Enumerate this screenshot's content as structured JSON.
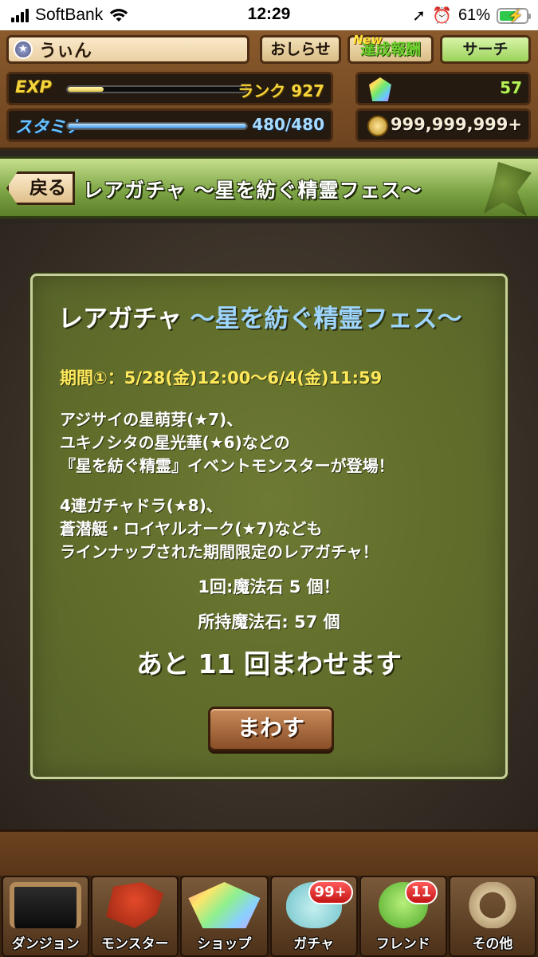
{
  "status_bar": {
    "carrier": "SoftBank",
    "time": "12:29",
    "battery": "61%",
    "battery_level": 0.61
  },
  "header": {
    "player_name": "うぃん",
    "buttons": {
      "news": "おしらせ",
      "achievements": "達成報酬",
      "achievements_badge": "New",
      "search": "サーチ"
    },
    "exp": {
      "label": "EXP",
      "rank": "ランク 927",
      "progress": 0.2
    },
    "stamina": {
      "label": "スタミナ",
      "value": "480/480",
      "progress": 1.0
    },
    "magic_stones": "57",
    "coins": "999,999,999+"
  },
  "banner": {
    "back_label": "戻る",
    "title": "レアガチャ ～星を紡ぐ精霊フェス～"
  },
  "panel": {
    "title_main": "レアガチャ",
    "title_accent": "～星を紡ぐ精霊フェス～",
    "period": "期間①：5/28(金)12:00～6/4(金)11:59",
    "desc1": [
      "アジサイの星萌芽(★7)、",
      "ユキノシタの星光華(★6)などの",
      "『星を紡ぐ精霊』イベントモンスターが登場！"
    ],
    "desc2": [
      "4連ガチャドラ(★8)、",
      "蒼潜艇・ロイヤルオーク(★7)なども",
      "ラインナップされた期間限定のレアガチャ！"
    ],
    "cost": "1回:魔法石 5 個！",
    "owned": "所持魔法石: 57 個",
    "remaining": "あと 11 回まわせます",
    "spin_button": "まわす"
  },
  "nav": {
    "items": [
      {
        "label": "ダンジョン"
      },
      {
        "label": "モンスター"
      },
      {
        "label": "ショップ"
      },
      {
        "label": "ガチャ",
        "badge": "99+"
      },
      {
        "label": "フレンド",
        "badge": "11"
      },
      {
        "label": "その他"
      }
    ]
  },
  "colors": {
    "panel_bg": "#5f6c2a",
    "accent_blue": "#9fd6ff",
    "period_yellow": "#ffe95a",
    "banner_green": "#7ea646"
  }
}
